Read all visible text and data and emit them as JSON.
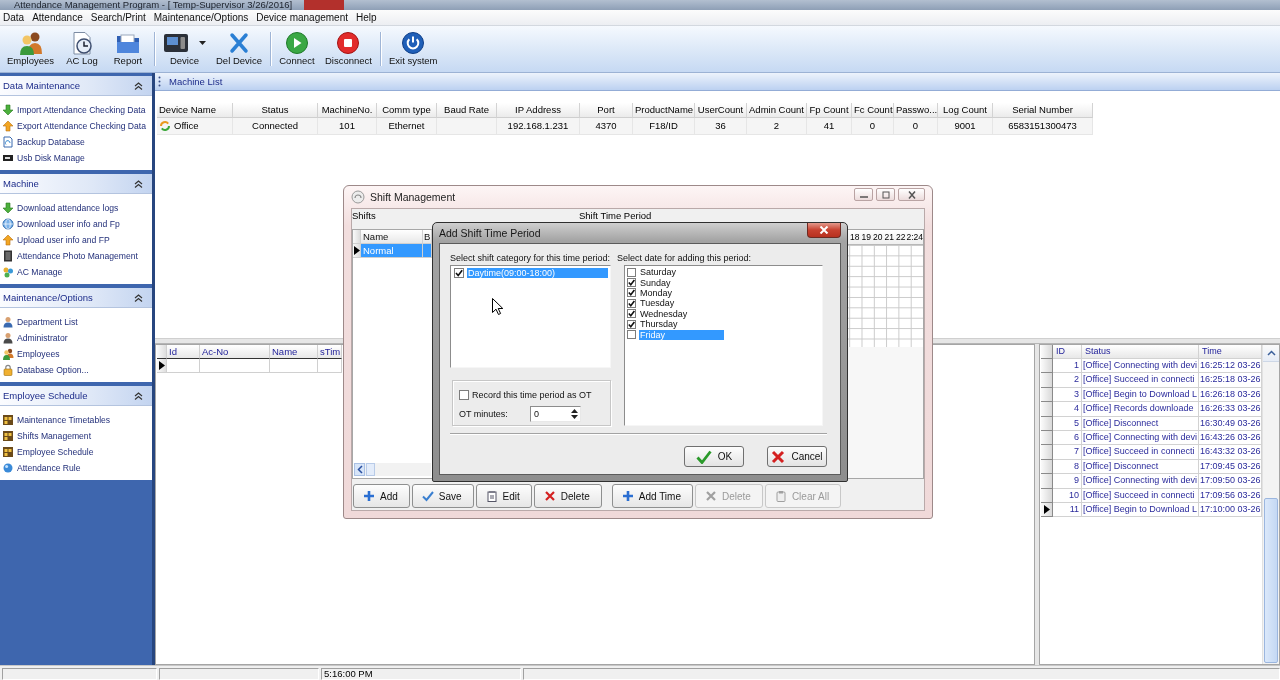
{
  "window": {
    "title": "Attendance Management Program - [ Temp-Supervisor 3/26/2016]"
  },
  "menu": [
    "Data",
    "Attendance",
    "Search/Print",
    "Maintenance/Options",
    "Device management",
    "Help"
  ],
  "toolbar": {
    "groups": [
      {
        "buttons": [
          {
            "label": "Employees",
            "dropdown": false
          },
          {
            "label": "AC Log",
            "dropdown": false
          },
          {
            "label": "Report",
            "dropdown": false
          }
        ]
      },
      {
        "buttons": [
          {
            "label": "Device",
            "dropdown": true
          },
          {
            "label": "Del Device",
            "dropdown": false
          }
        ]
      },
      {
        "buttons": [
          {
            "label": "Connect",
            "dropdown": false
          },
          {
            "label": "Disconnect",
            "dropdown": false
          }
        ]
      },
      {
        "buttons": [
          {
            "label": "Exit system",
            "dropdown": false
          }
        ]
      }
    ]
  },
  "sidebar": {
    "sections": [
      {
        "title": "Data Maintenance",
        "expanded": true,
        "items": [
          "Import Attendance Checking Data",
          "Export Attendance Checking Data",
          "Backup Database",
          "Usb Disk Manage"
        ]
      },
      {
        "title": "Machine",
        "expanded": true,
        "items": [
          "Download attendance logs",
          "Download user info and Fp",
          "Upload user info and FP",
          "Attendance Photo Management",
          "AC Manage"
        ]
      },
      {
        "title": "Maintenance/Options",
        "expanded": true,
        "items": [
          "Department List",
          "Administrator",
          "Employees",
          "Database Option..."
        ]
      },
      {
        "title": "Employee Schedule",
        "expanded": true,
        "items": [
          "Maintenance Timetables",
          "Shifts Management",
          "Employee Schedule",
          "Attendance Rule"
        ]
      }
    ]
  },
  "machine_list": {
    "title": "Machine List",
    "columns": [
      "Device Name",
      "Status",
      "MachineNo.",
      "Comm type",
      "Baud Rate",
      "IP Address",
      "Port",
      "ProductName",
      "UserCount",
      "Admin Count",
      "Fp Count",
      "Fc Count",
      "Passwo...",
      "Log Count",
      "Serial Number"
    ],
    "rows": [
      {
        "cells": [
          "Office",
          "Connected",
          "101",
          "Ethernet",
          null,
          "192.168.1.231",
          "4370",
          "F18/ID",
          "36",
          "2",
          "41",
          "0",
          "0",
          "9001",
          "6583151300473"
        ]
      }
    ]
  },
  "records_table": {
    "columns": [
      "Id",
      "Ac-No",
      "Name",
      "sTim"
    ],
    "rows": [
      {
        "current": true
      }
    ]
  },
  "log_table": {
    "columns": [
      "ID",
      "Status",
      "Time"
    ],
    "rows": [
      {
        "id": "1",
        "status": "[Office] Connecting with devi",
        "time": "16:25:12 03-26",
        "current": false
      },
      {
        "id": "2",
        "status": "[Office] Succeed in connecti",
        "time": "16:25:18 03-26",
        "current": false
      },
      {
        "id": "3",
        "status": "[Office] Begin to Download L",
        "time": "16:26:18 03-26",
        "current": false
      },
      {
        "id": "4",
        "status": "[Office] Records downloade",
        "time": "16:26:33 03-26",
        "current": false
      },
      {
        "id": "5",
        "status": "[Office] Disconnect",
        "time": "16:30:49 03-26",
        "current": false
      },
      {
        "id": "6",
        "status": "[Office] Connecting with devi",
        "time": "16:43:26 03-26",
        "current": false
      },
      {
        "id": "7",
        "status": "[Office] Succeed in connecti",
        "time": "16:43:32 03-26",
        "current": false
      },
      {
        "id": "8",
        "status": "[Office] Disconnect",
        "time": "17:09:45 03-26",
        "current": false
      },
      {
        "id": "9",
        "status": "[Office] Connecting with devi",
        "time": "17:09:50 03-26",
        "current": false
      },
      {
        "id": "10",
        "status": "[Office] Succeed in connecti",
        "time": "17:09:56 03-26",
        "current": false
      },
      {
        "id": "11",
        "status": "[Office] Begin to Download L",
        "time": "17:10:00 03-26",
        "current": true
      }
    ]
  },
  "status_bar": {
    "time": "5:16:00 PM"
  },
  "shift_management": {
    "title": "Shift Management",
    "shifts_label": "Shifts",
    "period_label": "Shift Time Period",
    "columns": [
      "Name",
      "B"
    ],
    "shifts": [
      {
        "name": "Normal",
        "selected": true,
        "current": true
      }
    ],
    "hours": [
      "18",
      "19",
      "20",
      "21",
      "22",
      "2:24"
    ],
    "shift_buttons": [
      {
        "label": "Add",
        "disabled": false
      },
      {
        "label": "Save",
        "disabled": false
      },
      {
        "label": "Edit",
        "disabled": false
      },
      {
        "label": "Delete",
        "disabled": false
      }
    ],
    "time_buttons": [
      {
        "label": "Add Time",
        "disabled": false
      },
      {
        "label": "Delete",
        "disabled": true
      },
      {
        "label": "Clear All",
        "disabled": true
      }
    ]
  },
  "add_period_dialog": {
    "title": "Add Shift Time Period",
    "category_label": "Select shift category for this time period:",
    "categories": [
      {
        "label": "Daytime(09:00-18:00)",
        "checked": true,
        "selected": true
      }
    ],
    "date_label": "Select date for adding this period:",
    "days": [
      {
        "label": "Saturday",
        "checked": false,
        "selected": false
      },
      {
        "label": "Sunday",
        "checked": true,
        "selected": false
      },
      {
        "label": "Monday",
        "checked": true,
        "selected": false
      },
      {
        "label": "Tuesday",
        "checked": true,
        "selected": false
      },
      {
        "label": "Wednesday",
        "checked": true,
        "selected": false
      },
      {
        "label": "Thursday",
        "checked": true,
        "selected": false
      },
      {
        "label": "Friday",
        "checked": false,
        "selected": true
      }
    ],
    "ot": {
      "label": "Record this time period as OT",
      "checked": false,
      "minutes_label": "OT minutes:",
      "minutes": "0"
    },
    "buttons": [
      "OK",
      "Cancel"
    ]
  }
}
